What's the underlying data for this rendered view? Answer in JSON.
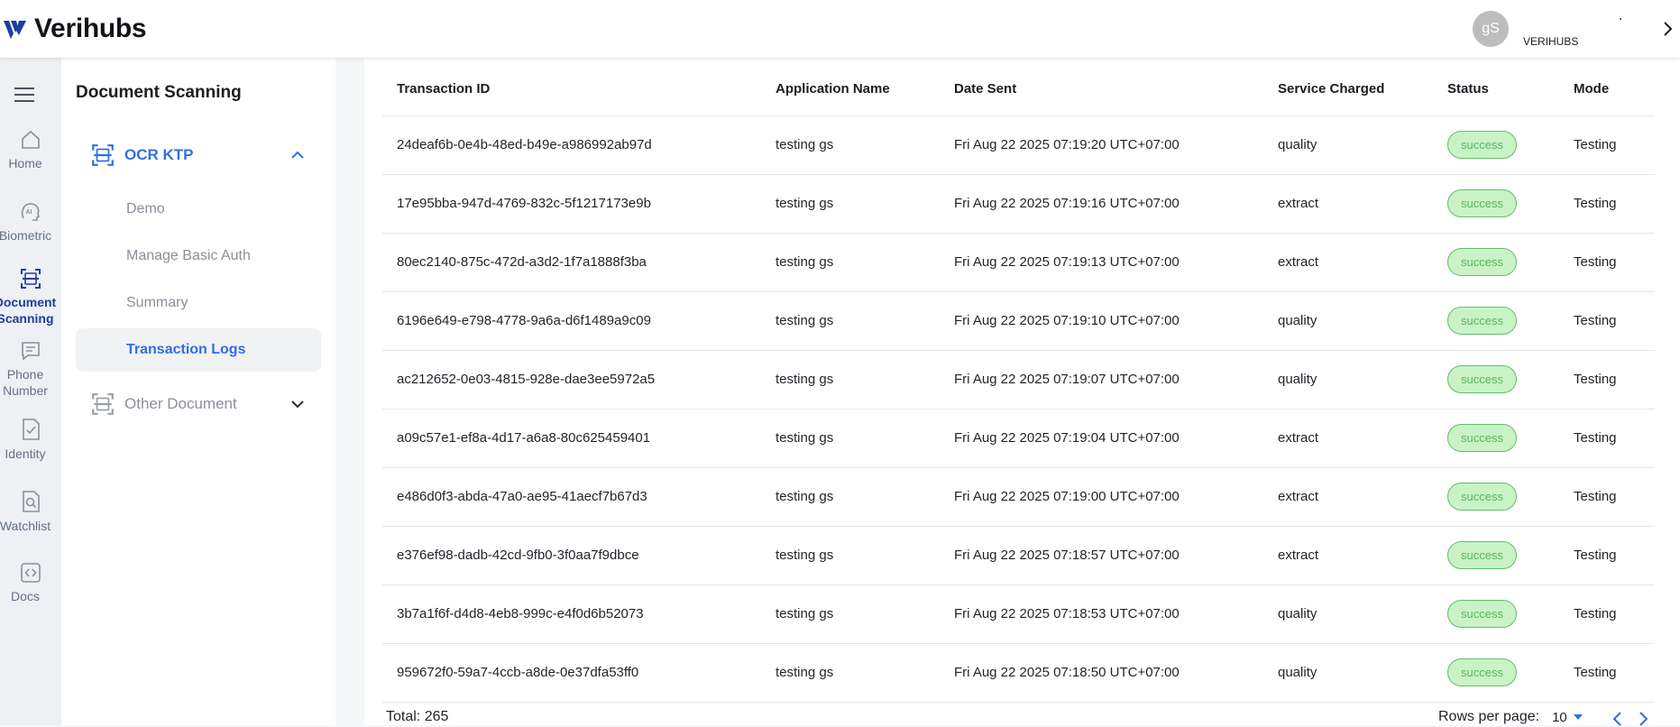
{
  "app": {
    "name": "Verihubs",
    "brand_color": "#1a3fa1"
  },
  "user": {
    "initials": "gS",
    "org": "VERIHUBS",
    "name_mark": "."
  },
  "rail": [
    {
      "label": "Home",
      "icon": "home-icon"
    },
    {
      "label": "Biometric",
      "icon": "ai-face-icon"
    },
    {
      "label": "Document Scanning",
      "icon": "document-scan-icon",
      "active": true
    },
    {
      "label": "Phone Number",
      "icon": "chat-icon"
    },
    {
      "label": "Identity",
      "icon": "document-check-icon"
    },
    {
      "label": "Watchlist",
      "icon": "document-search-icon"
    },
    {
      "label": "Docs",
      "icon": "code-icon"
    }
  ],
  "sidebar": {
    "title": "Document Scanning",
    "groups": [
      {
        "label": "OCR KTP",
        "expanded": true,
        "items": [
          "Demo",
          "Manage Basic Auth",
          "Summary",
          "Transaction Logs"
        ],
        "active_item": "Transaction Logs"
      },
      {
        "label": "Other Document",
        "expanded": false
      }
    ]
  },
  "table": {
    "columns": [
      "Transaction ID",
      "Application Name",
      "Date Sent",
      "Service Charged",
      "Status",
      "Mode"
    ],
    "rows": [
      [
        "24deaf6b-0e4b-48ed-b49e-a986992ab97d",
        "testing gs",
        "Fri Aug 22 2025 07:19:20 UTC+07:00",
        "quality",
        "success",
        "Testing"
      ],
      [
        "17e95bba-947d-4769-832c-5f1217173e9b",
        "testing gs",
        "Fri Aug 22 2025 07:19:16 UTC+07:00",
        "extract",
        "success",
        "Testing"
      ],
      [
        "80ec2140-875c-472d-a3d2-1f7a1888f3ba",
        "testing gs",
        "Fri Aug 22 2025 07:19:13 UTC+07:00",
        "extract",
        "success",
        "Testing"
      ],
      [
        "6196e649-e798-4778-9a6a-d6f1489a9c09",
        "testing gs",
        "Fri Aug 22 2025 07:19:10 UTC+07:00",
        "quality",
        "success",
        "Testing"
      ],
      [
        "ac212652-0e03-4815-928e-dae3ee5972a5",
        "testing gs",
        "Fri Aug 22 2025 07:19:07 UTC+07:00",
        "quality",
        "success",
        "Testing"
      ],
      [
        "a09c57e1-ef8a-4d17-a6a8-80c625459401",
        "testing gs",
        "Fri Aug 22 2025 07:19:04 UTC+07:00",
        "extract",
        "success",
        "Testing"
      ],
      [
        "e486d0f3-abda-47a0-ae95-41aecf7b67d3",
        "testing gs",
        "Fri Aug 22 2025 07:19:00 UTC+07:00",
        "extract",
        "success",
        "Testing"
      ],
      [
        "e376ef98-dadb-42cd-9fb0-3f0aa7f9dbce",
        "testing gs",
        "Fri Aug 22 2025 07:18:57 UTC+07:00",
        "extract",
        "success",
        "Testing"
      ],
      [
        "3b7a1f6f-d4d8-4eb8-999c-e4f0d6b52073",
        "testing gs",
        "Fri Aug 22 2025 07:18:53 UTC+07:00",
        "quality",
        "success",
        "Testing"
      ],
      [
        "959672f0-59a7-4ccb-a8de-0e37dfa53ff0",
        "testing gs",
        "Fri Aug 22 2025 07:18:50 UTC+07:00",
        "quality",
        "success",
        "Testing"
      ]
    ]
  },
  "footer": {
    "total": "Total: 265",
    "rows_per_page_label": "Rows per page:",
    "rows_per_page": "10"
  },
  "colors": {
    "accent": "#2f6fe4",
    "success_bg": "#c9f3c5",
    "success_border": "#5fbf6b",
    "success_text": "#58b461"
  }
}
